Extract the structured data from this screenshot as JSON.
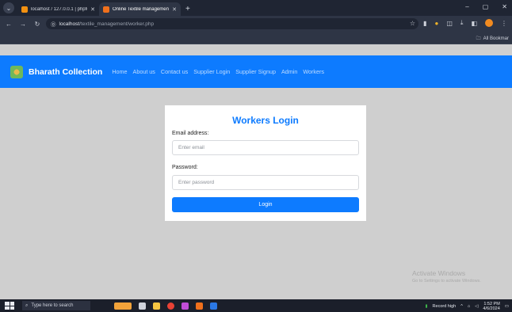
{
  "browser": {
    "tabs": [
      {
        "label": "localhost / 127.0.0.1 | phpMyA",
        "favicon_color": "#f29111",
        "active": false
      },
      {
        "label": "Online Textile management sys",
        "favicon_color": "#f0701c",
        "active": true
      }
    ],
    "new_tab_glyph": "+",
    "url_host": "localhost",
    "url_path": "/textile_management/worker.php",
    "bookmarks_label": "All Bookmar"
  },
  "site": {
    "brand": "Bharath Collection",
    "nav": [
      "Home",
      "About us",
      "Contact us",
      "Supplier Login",
      "Supplier Signup",
      "Admin",
      "Workers"
    ],
    "accent": "#0d7bff"
  },
  "login": {
    "title": "Workers Login",
    "email_label": "Email address:",
    "email_placeholder": "Enter email",
    "password_label": "Password:",
    "password_placeholder": "Enter password",
    "button": "Login"
  },
  "watermark": {
    "line1": "Activate Windows",
    "line2": "Go to Settings to activate Windows."
  },
  "taskbar": {
    "search_placeholder": "Type here to search",
    "record_label": "Record high",
    "time": "1:52 PM",
    "date": "4/6/2024"
  }
}
